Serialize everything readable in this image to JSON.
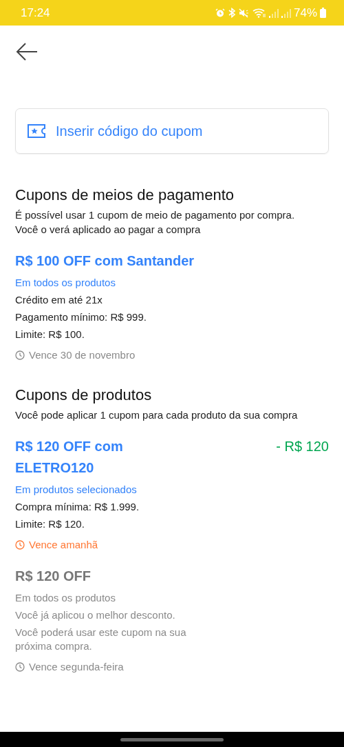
{
  "status_bar": {
    "time": "17:24",
    "battery": "74%"
  },
  "coupon_field": {
    "placeholder": "Inserir código do cupom"
  },
  "sections": [
    {
      "title": "Cupons de meios de pagamento",
      "subtitle": "É possível usar 1 cupom de meio de pagamento por compra. Você o verá aplicado ao pagar a compra",
      "coupons": [
        {
          "title": "R$ 100 OFF com Santander",
          "scope": "Em todos os produtos",
          "details": [
            "Crédito em até 21x",
            "Pagamento mínimo: R$ 999.",
            "Limite: R$ 100."
          ],
          "expiry": "Vence 30 de novembro",
          "urgent": false,
          "disabled": false
        }
      ]
    },
    {
      "title": "Cupons de produtos",
      "subtitle": "Você pode aplicar 1 cupom para cada produto da sua compra",
      "coupons": [
        {
          "title": "R$ 120 OFF com ELETRO120",
          "discount": "- R$ 120",
          "scope": "Em produtos selecionados",
          "details": [
            "Compra mínima: R$ 1.999.",
            "Limite: R$ 120."
          ],
          "expiry": "Vence amanhã",
          "urgent": true,
          "disabled": false
        },
        {
          "title": "R$ 120 OFF",
          "scope": "Em todos os produtos",
          "details": [
            "Você já aplicou o melhor desconto.",
            "Você poderá usar este cupom na sua próxima compra."
          ],
          "expiry": "Vence segunda-feira",
          "urgent": false,
          "disabled": true
        }
      ]
    }
  ]
}
